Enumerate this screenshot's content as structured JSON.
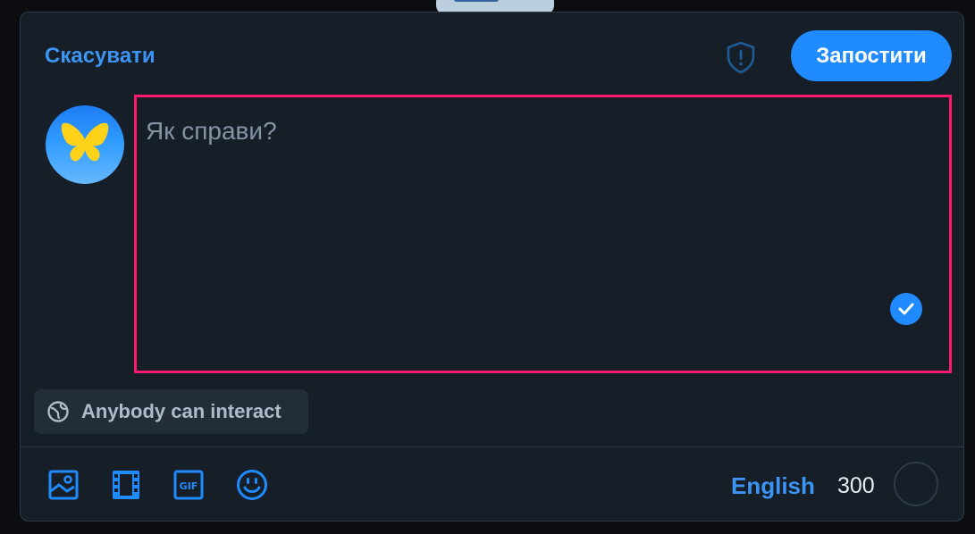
{
  "header": {
    "cancel_label": "Скасувати",
    "post_label": "Запостити",
    "shield_icon": "shield-exclamation-icon"
  },
  "composer": {
    "placeholder": "Як справи?",
    "avatar_icon": "butterfly-icon"
  },
  "interaction_settings": {
    "label": "Anybody can interact",
    "icon": "globe-icon"
  },
  "toolbar": {
    "tools": [
      "image-icon",
      "video-icon",
      "gif-icon",
      "emoji-icon"
    ],
    "language": "English",
    "char_count": "300"
  },
  "colors": {
    "accent": "#208bfe",
    "link": "#3c94f4",
    "focus_outline": "#ff1a6d",
    "panel": "#161e27"
  }
}
